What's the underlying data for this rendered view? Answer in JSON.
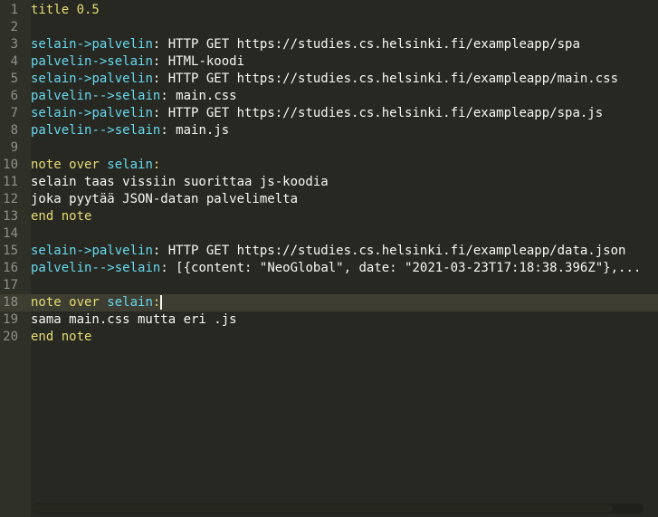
{
  "editor": {
    "cursor_line": 18,
    "horizontal_scroll_fraction": 0.95,
    "lines": [
      {
        "n": "1",
        "tokens": [
          {
            "t": "kw",
            "v": "title 0.5"
          }
        ]
      },
      {
        "n": "2",
        "tokens": []
      },
      {
        "n": "3",
        "tokens": [
          {
            "t": "actor",
            "v": "selain"
          },
          {
            "t": "arrow",
            "v": "->"
          },
          {
            "t": "actor",
            "v": "palvelin"
          },
          {
            "t": "text",
            "v": ": HTTP GET https://studies.cs.helsinki.fi/exampleapp/spa"
          }
        ]
      },
      {
        "n": "4",
        "tokens": [
          {
            "t": "actor",
            "v": "palvelin"
          },
          {
            "t": "arrow",
            "v": "->"
          },
          {
            "t": "actor",
            "v": "selain"
          },
          {
            "t": "text",
            "v": ": HTML-koodi"
          }
        ]
      },
      {
        "n": "5",
        "tokens": [
          {
            "t": "actor",
            "v": "selain"
          },
          {
            "t": "arrow",
            "v": "->"
          },
          {
            "t": "actor",
            "v": "palvelin"
          },
          {
            "t": "text",
            "v": ": HTTP GET https://studies.cs.helsinki.fi/exampleapp/main.css"
          }
        ]
      },
      {
        "n": "6",
        "tokens": [
          {
            "t": "actor",
            "v": "palvelin"
          },
          {
            "t": "arrow",
            "v": "-->"
          },
          {
            "t": "actor",
            "v": "selain"
          },
          {
            "t": "text",
            "v": ": main.css"
          }
        ]
      },
      {
        "n": "7",
        "tokens": [
          {
            "t": "actor",
            "v": "selain"
          },
          {
            "t": "arrow",
            "v": "->"
          },
          {
            "t": "actor",
            "v": "palvelin"
          },
          {
            "t": "text",
            "v": ": HTTP GET https://studies.cs.helsinki.fi/exampleapp/spa.js"
          }
        ]
      },
      {
        "n": "8",
        "tokens": [
          {
            "t": "actor",
            "v": "palvelin"
          },
          {
            "t": "arrow",
            "v": "-->"
          },
          {
            "t": "actor",
            "v": "selain"
          },
          {
            "t": "text",
            "v": ": main.js"
          }
        ]
      },
      {
        "n": "9",
        "tokens": []
      },
      {
        "n": "10",
        "tokens": [
          {
            "t": "kw",
            "v": "note over "
          },
          {
            "t": "actor",
            "v": "selain"
          },
          {
            "t": "kw",
            "v": ":"
          }
        ]
      },
      {
        "n": "11",
        "tokens": [
          {
            "t": "text",
            "v": "selain taas vissiin suorittaa js-koodia"
          }
        ]
      },
      {
        "n": "12",
        "tokens": [
          {
            "t": "text",
            "v": "joka pyytää JSON-datan palvelimelta"
          }
        ]
      },
      {
        "n": "13",
        "tokens": [
          {
            "t": "kw",
            "v": "end note"
          }
        ]
      },
      {
        "n": "14",
        "tokens": []
      },
      {
        "n": "15",
        "tokens": [
          {
            "t": "actor",
            "v": "selain"
          },
          {
            "t": "arrow",
            "v": "->"
          },
          {
            "t": "actor",
            "v": "palvelin"
          },
          {
            "t": "text",
            "v": ": HTTP GET https://studies.cs.helsinki.fi/exampleapp/data.json"
          }
        ]
      },
      {
        "n": "16",
        "tokens": [
          {
            "t": "actor",
            "v": "palvelin"
          },
          {
            "t": "arrow",
            "v": "-->"
          },
          {
            "t": "actor",
            "v": "selain"
          },
          {
            "t": "text",
            "v": ": [{content: \"NeoGlobal\", date: \"2021-03-23T17:18:38.396Z\"},..."
          }
        ]
      },
      {
        "n": "17",
        "tokens": []
      },
      {
        "n": "18",
        "tokens": [
          {
            "t": "kw",
            "v": "note over "
          },
          {
            "t": "actor",
            "v": "selain"
          },
          {
            "t": "kw",
            "v": ":"
          }
        ]
      },
      {
        "n": "19",
        "tokens": [
          {
            "t": "text",
            "v": "sama main.css mutta eri .js"
          }
        ]
      },
      {
        "n": "20",
        "tokens": [
          {
            "t": "kw",
            "v": "end note"
          }
        ]
      }
    ]
  }
}
